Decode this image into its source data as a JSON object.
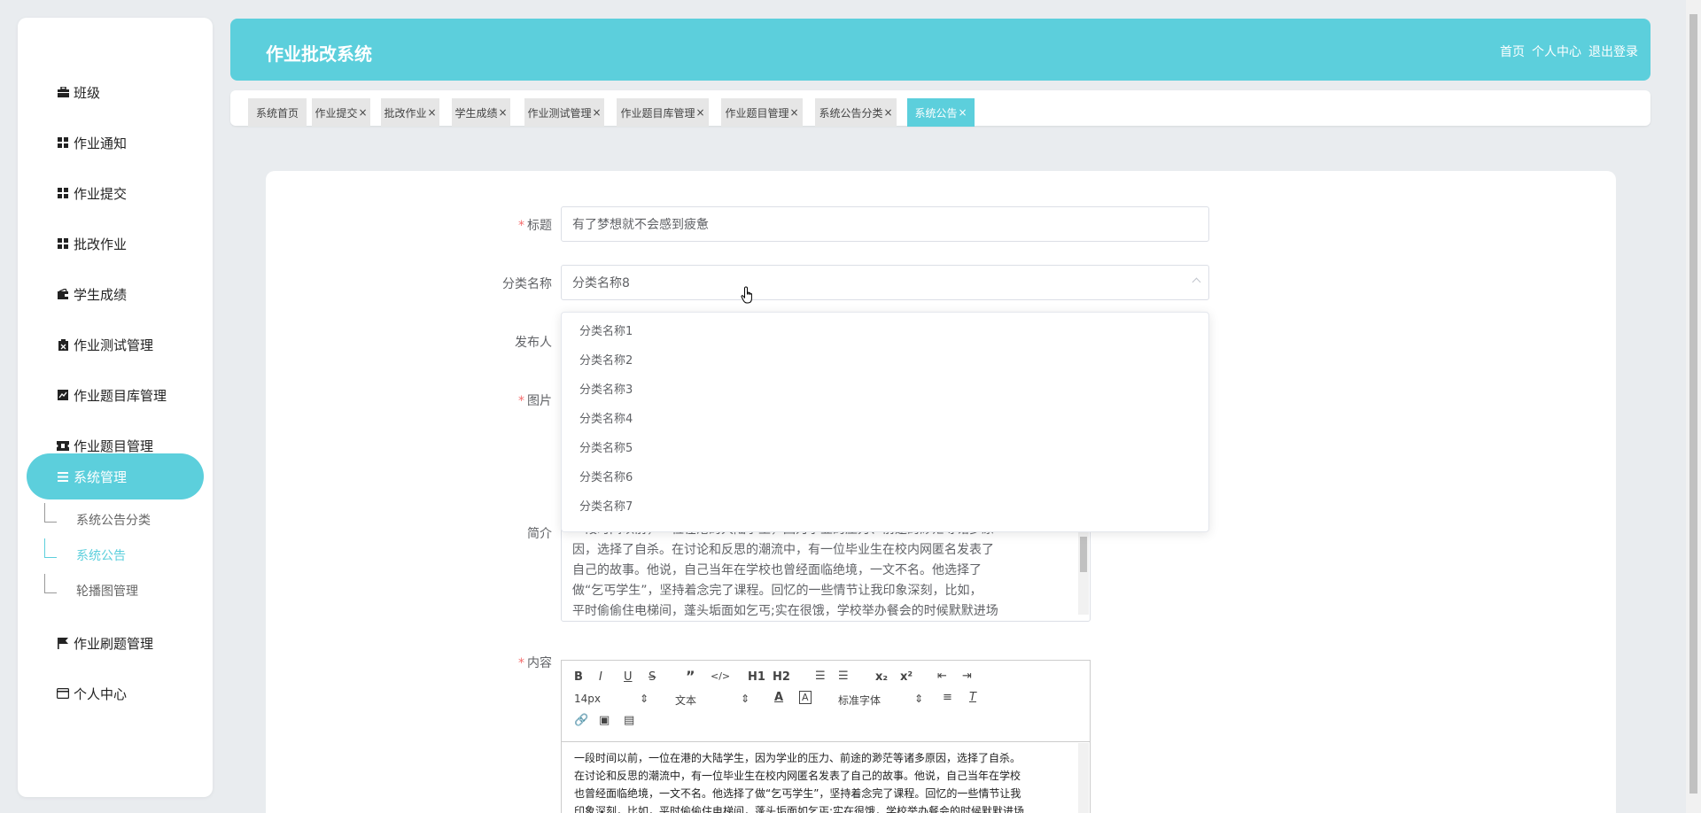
{
  "app": {
    "title": "作业批改系统",
    "header_links": [
      "首页",
      "个人中心",
      "退出登录"
    ]
  },
  "sidebar": {
    "items": [
      {
        "label": "班级",
        "icon": "briefcase-icon"
      },
      {
        "label": "作业通知",
        "icon": "grid-icon"
      },
      {
        "label": "作业提交",
        "icon": "grid-icon"
      },
      {
        "label": "批改作业",
        "icon": "grid-icon"
      },
      {
        "label": "学生成绩",
        "icon": "wallet-icon"
      },
      {
        "label": "作业测试管理",
        "icon": "clipboard-icon"
      },
      {
        "label": "作业题目库管理",
        "icon": "chart-icon"
      },
      {
        "label": "作业题目管理",
        "icon": "ticket-icon"
      },
      {
        "label": "系统管理",
        "icon": "list-icon"
      },
      {
        "label": "作业刷题管理",
        "icon": "flag-icon"
      },
      {
        "label": "个人中心",
        "icon": "card-icon"
      }
    ],
    "sub_items": [
      "系统公告分类",
      "系统公告",
      "轮播图管理"
    ]
  },
  "tabs": [
    "系统首页",
    "作业提交",
    "批改作业",
    "学生成绩",
    "作业测试管理",
    "作业题目库管理",
    "作业题目管理",
    "系统公告分类",
    "系统公告"
  ],
  "form": {
    "title_label": "标题",
    "title_value": "有了梦想就不会感到疲惫",
    "category_label": "分类名称",
    "category_value": "分类名称8",
    "publisher_label": "发布人",
    "image_label": "图片",
    "intro_label": "简介",
    "intro_lines": [
      "一段时间以前，一位在港的大陆学生，因为学业的压力、前途的渺茫等诸多原",
      "因，选择了自杀。在讨论和反思的潮流中，有一位毕业生在校内网匿名发表了",
      "自己的故事。他说，自己当年在学校也曾经面临绝境，一文不名。他选择了",
      "做“乞丐学生”，坚持着念完了课程。回忆的一些情节让我印象深刻，比如，",
      "平时偷偷住电梯间，蓬头垢面如乞丐;实在很饿，学校举办餐会的时候默默进场"
    ],
    "content_label": "内容"
  },
  "dropdown": {
    "options": [
      "分类名称1",
      "分类名称2",
      "分类名称3",
      "分类名称4",
      "分类名称5",
      "分类名称6",
      "分类名称7"
    ]
  },
  "editor": {
    "font_size": "14px",
    "block_format": "文本",
    "font_family": "标准字体",
    "content_lines": [
      "一段时间以前，一位在港的大陆学生，因为学业的压力、前途的渺茫等诸多原因，选择了自杀。",
      "在讨论和反思的潮流中，有一位毕业生在校内网匿名发表了自己的故事。他说，自己当年在学校",
      "也曾经面临绝境，一文不名。他选择了做“乞丐学生”，坚持着念完了课程。回忆的一些情节让我",
      "印象深刻，比如，平时偷偷住电梯间，蓬头垢面如乞丐;实在很饿，学校举办餐会的时候默默进场"
    ]
  },
  "colors": {
    "accent": "#5ccfdc",
    "required": "#f56c6c"
  }
}
